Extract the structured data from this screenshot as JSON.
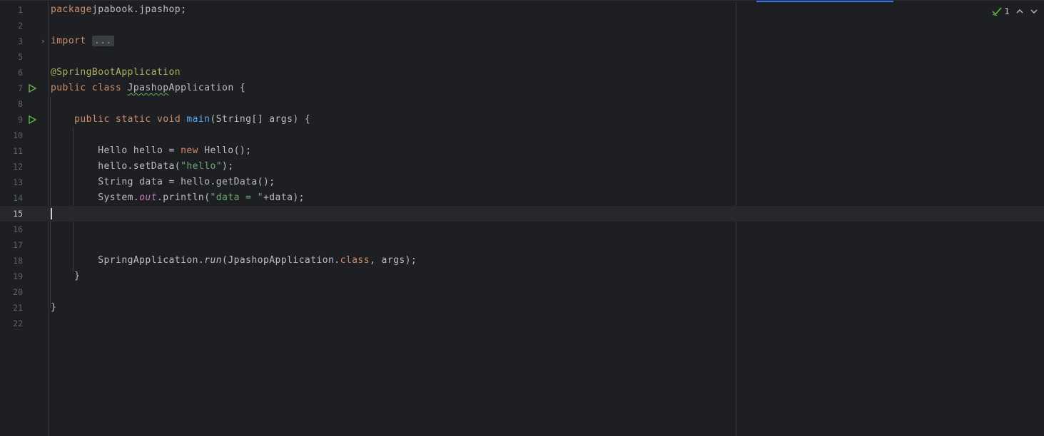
{
  "editor": {
    "inspection": {
      "count": "1",
      "check_icon": "check-icon"
    },
    "current_line": 15,
    "lines": [
      {
        "num": "1",
        "segments": [
          [
            "kw",
            "package"
          ],
          [
            "",
            "jpabook.jpashop;"
          ]
        ]
      },
      {
        "num": "2",
        "segments": []
      },
      {
        "num": "3",
        "segments": [
          [
            "kw",
            "import"
          ],
          [
            "",
            ""
          ],
          [
            "folded",
            "..."
          ]
        ],
        "fold": true
      },
      {
        "num": "5",
        "segments": []
      },
      {
        "num": "6",
        "segments": [
          [
            "ann",
            "@SpringBootApplication"
          ]
        ]
      },
      {
        "num": "7",
        "segments": [
          [
            "kw",
            "public class "
          ],
          [
            "squig",
            "Jpashop"
          ],
          [
            "",
            "Application {"
          ]
        ],
        "run": true
      },
      {
        "num": "8",
        "segments": []
      },
      {
        "num": "9",
        "segments": [
          [
            "",
            "    "
          ],
          [
            "kw",
            "public static void "
          ],
          [
            "fn",
            "main"
          ],
          [
            "",
            "(String[] args) {"
          ]
        ],
        "run": true
      },
      {
        "num": "10",
        "segments": []
      },
      {
        "num": "11",
        "segments": [
          [
            "",
            "        Hello hello = "
          ],
          [
            "kw",
            "new "
          ],
          [
            "",
            "Hello();"
          ]
        ]
      },
      {
        "num": "12",
        "segments": [
          [
            "",
            "        hello.setData("
          ],
          [
            "str",
            "\"hello\""
          ],
          [
            "",
            ");"
          ]
        ]
      },
      {
        "num": "13",
        "segments": [
          [
            "",
            "        String data = hello.getData();"
          ]
        ]
      },
      {
        "num": "14",
        "segments": [
          [
            "",
            "        System."
          ],
          [
            "fld",
            "out"
          ],
          [
            "",
            ".println("
          ],
          [
            "str",
            "\"data = \""
          ],
          [
            "",
            "+data);"
          ]
        ]
      },
      {
        "num": "15",
        "segments": [],
        "current": true
      },
      {
        "num": "16",
        "segments": []
      },
      {
        "num": "17",
        "segments": []
      },
      {
        "num": "18",
        "segments": [
          [
            "",
            "        SpringApplication."
          ],
          [
            "it",
            "run"
          ],
          [
            "",
            "(JpashopApplication."
          ],
          [
            "kw",
            "class"
          ],
          [
            "",
            ", args);"
          ]
        ]
      },
      {
        "num": "19",
        "segments": [
          [
            "",
            "    }"
          ]
        ]
      },
      {
        "num": "20",
        "segments": []
      },
      {
        "num": "21",
        "segments": [
          [
            "",
            "}"
          ]
        ]
      },
      {
        "num": "22",
        "segments": []
      }
    ]
  }
}
